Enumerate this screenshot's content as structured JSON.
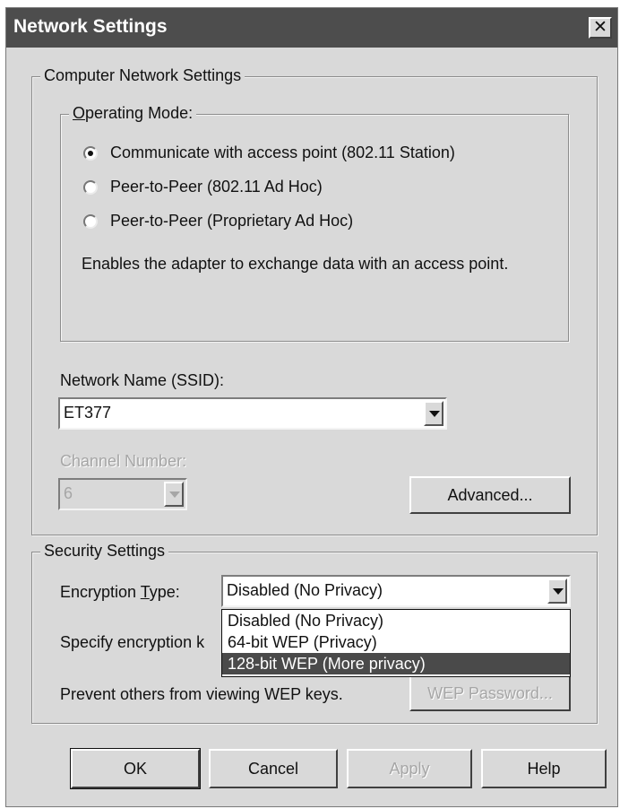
{
  "window": {
    "title": "Network Settings",
    "close_symbol": "✕"
  },
  "computer_network": {
    "legend": "Computer Network Settings",
    "operating_mode": {
      "legend": "Operating Mode:",
      "options": [
        {
          "label": "Communicate with access point (802.11 Station)",
          "selected": true
        },
        {
          "label": "Peer-to-Peer (802.11 Ad Hoc)",
          "selected": false
        },
        {
          "label": "Peer-to-Peer (Proprietary Ad Hoc)",
          "selected": false
        }
      ],
      "description": "Enables the adapter to exchange data with an access point."
    },
    "ssid": {
      "label": "Network Name (SSID):",
      "value": "ET377"
    },
    "channel": {
      "label": "Channel Number:",
      "value": "6"
    },
    "advanced_label": "Advanced..."
  },
  "security": {
    "legend": "Security Settings",
    "encryption_label": "Encryption Type:",
    "encryption_value": "Disabled (No Privacy)",
    "dropdown_options": [
      "Disabled (No Privacy)",
      "64-bit WEP (Privacy)",
      "128-bit WEP (More privacy)"
    ],
    "specify_label": "Specify encryption k",
    "prevent_label": "Prevent others from viewing WEP keys.",
    "wep_password_label": "WEP Password..."
  },
  "buttons": {
    "ok": "OK",
    "cancel": "Cancel",
    "apply": "Apply",
    "help": "Help"
  },
  "icons": {
    "close": "close-icon",
    "dropdown_arrow": "chevron-down-icon"
  }
}
